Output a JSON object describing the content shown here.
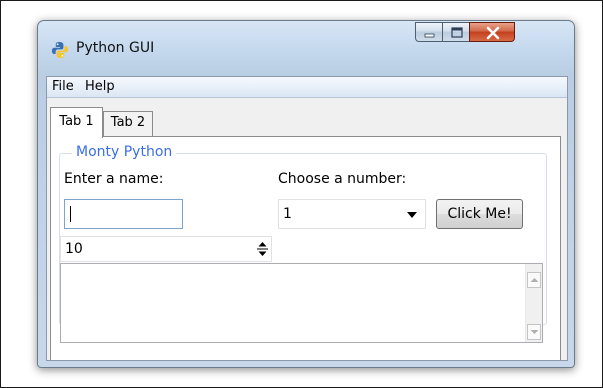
{
  "window": {
    "title": "Python GUI",
    "icon": "python-logo-icon"
  },
  "window_controls": {
    "minimize_icon": "minimize-icon",
    "maximize_icon": "maximize-icon",
    "close_icon": "close-icon"
  },
  "menubar": {
    "items": [
      {
        "label": "File"
      },
      {
        "label": "Help"
      }
    ]
  },
  "tabs": [
    {
      "label": "Tab 1",
      "selected": true
    },
    {
      "label": "Tab 2",
      "selected": false
    }
  ],
  "labelframe": {
    "title": "Monty Python",
    "name_label": "Enter a name:",
    "name_value": "",
    "number_label": "Choose a number:",
    "number_selected": "1",
    "button_label": "Click Me!",
    "spinbox_value": "10",
    "scrolled_text": ""
  },
  "colors": {
    "labelframe_title": "#3a6ee8",
    "entry_focus_border": "#7da2ce",
    "close_button": "#c4401e"
  }
}
